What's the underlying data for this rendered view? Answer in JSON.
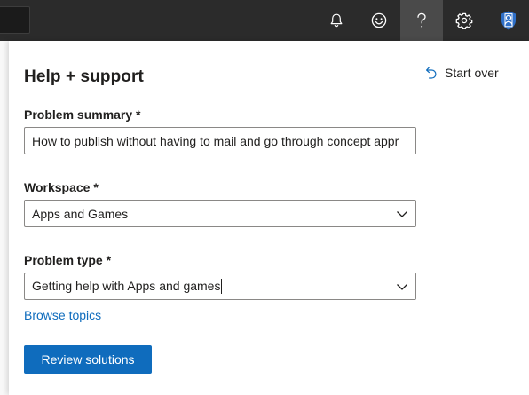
{
  "topbar": {
    "icons": [
      "bell-icon",
      "smiley-icon",
      "help-icon",
      "gear-icon",
      "avatar"
    ],
    "active": "help-icon"
  },
  "help": {
    "title": "Help + support",
    "start_over": "Start over",
    "problem_summary": {
      "label": "Problem summary *",
      "value": "How to publish without having to mail and go through concept appr"
    },
    "workspace": {
      "label": "Workspace *",
      "selected": "Apps and Games"
    },
    "problem_type": {
      "label": "Problem type *",
      "selected": "Getting help with Apps and games"
    },
    "browse_topics": "Browse topics",
    "review_button": "Review solutions"
  },
  "colors": {
    "topbar_bg": "#2b2b2b",
    "topbar_active": "#4a4a4a",
    "accent": "#0f6cbd",
    "avatar_bg": "#2e6fc8"
  }
}
